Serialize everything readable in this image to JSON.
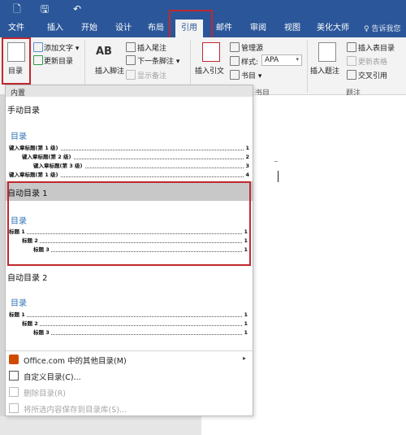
{
  "quick_access": {
    "new_icon": "document-icon",
    "save_icon": "save-icon",
    "undo_icon": "undo-icon"
  },
  "tabs": [
    {
      "label": "文件"
    },
    {
      "label": "插入"
    },
    {
      "label": "开始"
    },
    {
      "label": "设计"
    },
    {
      "label": "布局"
    },
    {
      "label": "引用"
    },
    {
      "label": "邮件"
    },
    {
      "label": "审阅"
    },
    {
      "label": "视图"
    },
    {
      "label": "美化大师"
    }
  ],
  "tell_me": "♀ 告诉我您",
  "ribbon": {
    "toc_button": "目录",
    "add_text": "添加文字 ▾",
    "update_toc": "更新目录",
    "insert_endnote": "插入尾注",
    "insert_footnote": "插入脚注",
    "next_footnote": "下一条脚注 ▾",
    "show_notes": "显示备注",
    "insert_citation": "插入引文",
    "manage_sources": "管理源",
    "style_label": "样式:",
    "style_value": "APA",
    "bibliography": "书目 ▾",
    "insert_caption": "插入题注",
    "insert_table_of_figures": "插入表目录",
    "update_table": "更新表格",
    "cross_reference": "交叉引用",
    "group_citations": "书目",
    "group_captions": "题注",
    "footnote_ab": "AB"
  },
  "dropdown": {
    "header": "内置",
    "manual_title": "手动目录",
    "manual_heading": "目录",
    "manual_lines": [
      {
        "text": "键入章标题(第 1 级)",
        "page": "1"
      },
      {
        "text": "键入章标题(第 2 级)",
        "page": "2"
      },
      {
        "text": "键入章标题(第 3 级)",
        "page": "3"
      },
      {
        "text": "键入章标题(第 1 级)",
        "page": "4"
      }
    ],
    "auto1_title": "自动目录 1",
    "auto1_heading": "目录",
    "auto1_lines": [
      {
        "text": "标题 1",
        "page": "1"
      },
      {
        "text": "标题 2",
        "page": "1"
      },
      {
        "text": "标题 3",
        "page": "1"
      }
    ],
    "auto2_title": "自动目录 2",
    "auto2_heading": "目录",
    "auto2_lines": [
      {
        "text": "标题 1",
        "page": "1"
      },
      {
        "text": "标题 2",
        "page": "1"
      },
      {
        "text": "标题 3",
        "page": "1"
      }
    ],
    "menu": [
      {
        "label": "Office.com 中的其他目录(M)",
        "disabled": false
      },
      {
        "label": "自定义目录(C)...",
        "disabled": false
      },
      {
        "label": "删除目录(R)",
        "disabled": true
      },
      {
        "label": "将所选内容保存到目录库(S)...",
        "disabled": true
      }
    ]
  },
  "colors": {
    "accent": "#2b579a",
    "highlight": "#c0282e",
    "toc_heading": "#2e74b5"
  }
}
